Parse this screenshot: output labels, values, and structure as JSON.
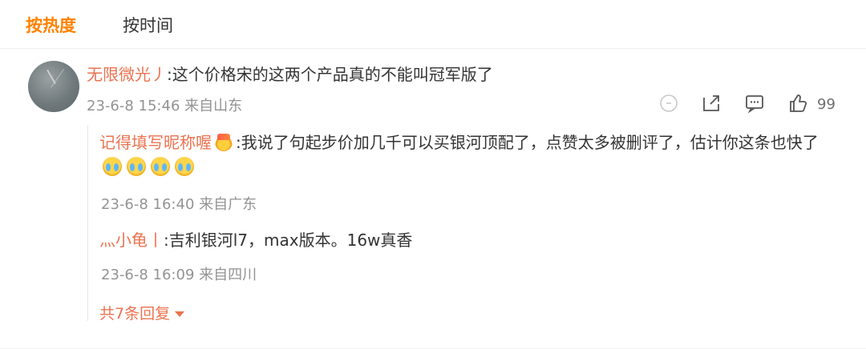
{
  "tabs": {
    "hot": "按热度",
    "time": "按时间"
  },
  "main_comment": {
    "username": "无限微光丿",
    "separator": ":",
    "text": "这个价格宋的这两个产品真的不能叫冠军版了",
    "meta": "23-6-8 15:46 来自山东",
    "likes": "99",
    "icons": [
      "circle-icon",
      "share-icon",
      "comment-icon",
      "like-icon"
    ]
  },
  "replies": [
    {
      "username": "记得填写昵称喔",
      "separator": ":",
      "text": "我说了句起步价加几千可以买银河顶配了，点赞太多被删评了，估计你这条也快了",
      "meta": "23-6-8 16:40 来自广东",
      "badge_icon": "medal-icon",
      "emoji_icons": [
        "crying-face-icon",
        "crying-face-icon",
        "crying-face-icon",
        "crying-face-icon"
      ]
    },
    {
      "username": "灬小龟丨",
      "separator": ":",
      "text": "吉利银河l7，max版本。16w真香",
      "meta": "23-6-8 16:09 来自四川"
    }
  ],
  "more_replies_label": "共7条回复",
  "colors": {
    "accent": "#ff8200",
    "username": "#eb7350",
    "meta": "#939393",
    "text": "#333333"
  }
}
